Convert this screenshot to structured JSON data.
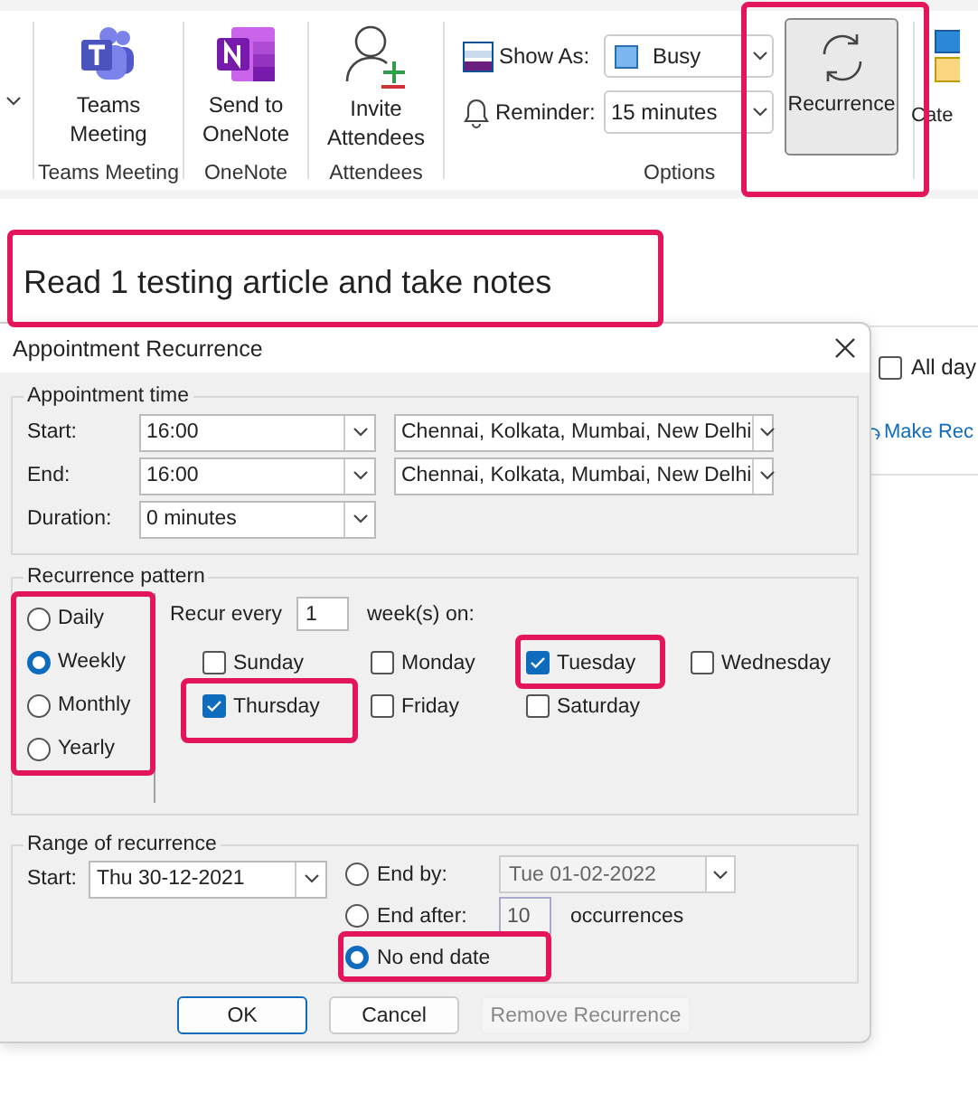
{
  "ribbon": {
    "groups": [
      {
        "label": "Teams Meeting",
        "button": {
          "label": "Teams Meeting"
        }
      },
      {
        "label": "OneNote",
        "button": {
          "label": "Send to OneNote"
        }
      },
      {
        "label": "Attendees",
        "button": {
          "label": "Invite Attendees"
        }
      }
    ],
    "options": {
      "label": "Options",
      "show_as": {
        "label": "Show As:",
        "value": "Busy",
        "color": "#7cb6ee"
      },
      "reminder": {
        "label": "Reminder:",
        "value": "15 minutes"
      },
      "recurrence_button": "Recurrence"
    },
    "cut_button": "Cate"
  },
  "subject": "Read 1 testing article and take notes",
  "all_day": {
    "label": "All day",
    "checked": false
  },
  "make_recurring_link": "Make Rec",
  "dialog": {
    "title": "Appointment Recurrence",
    "appointment_time": {
      "legend": "Appointment time",
      "start": {
        "label": "Start:",
        "time": "16:00",
        "timezone": "Chennai, Kolkata, Mumbai, New Delhi"
      },
      "end": {
        "label": "End:",
        "time": "16:00",
        "timezone": "Chennai, Kolkata, Mumbai, New Delhi"
      },
      "duration": {
        "label": "Duration:",
        "value": "0 minutes"
      }
    },
    "recurrence_pattern": {
      "legend": "Recurrence pattern",
      "frequencies": [
        {
          "label": "Daily",
          "selected": false
        },
        {
          "label": "Weekly",
          "selected": true
        },
        {
          "label": "Monthly",
          "selected": false
        },
        {
          "label": "Yearly",
          "selected": false
        }
      ],
      "recur_every_label": "Recur every",
      "interval": "1",
      "unit_label": "week(s) on:",
      "days": [
        {
          "label": "Sunday",
          "checked": false
        },
        {
          "label": "Monday",
          "checked": false
        },
        {
          "label": "Tuesday",
          "checked": true
        },
        {
          "label": "Wednesday",
          "checked": false
        },
        {
          "label": "Thursday",
          "checked": true
        },
        {
          "label": "Friday",
          "checked": false
        },
        {
          "label": "Saturday",
          "checked": false
        }
      ]
    },
    "range": {
      "legend": "Range of recurrence",
      "start_label": "Start:",
      "start_value": "Thu 30-12-2021",
      "end_by": {
        "label": "End by:",
        "value": "Tue 01-02-2022",
        "selected": false
      },
      "end_after": {
        "label": "End after:",
        "value": "10",
        "suffix": "occurrences",
        "selected": false
      },
      "no_end": {
        "label": "No end date",
        "selected": true
      }
    },
    "buttons": [
      {
        "label": "OK",
        "disabled": false,
        "default": true
      },
      {
        "label": "Cancel",
        "disabled": false,
        "default": false
      },
      {
        "label": "Remove Recurrence",
        "disabled": true,
        "default": false
      }
    ]
  }
}
